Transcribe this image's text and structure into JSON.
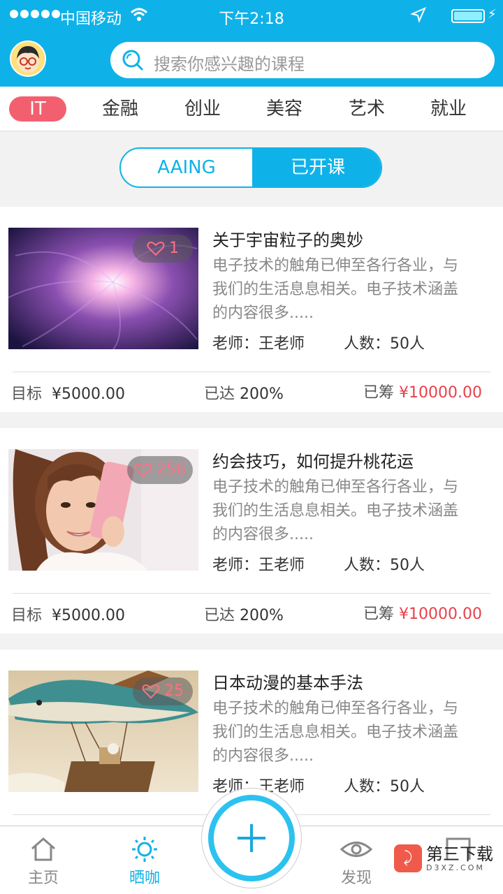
{
  "status_bar": {
    "carrier": "中国移动",
    "time": "下午2:18"
  },
  "search": {
    "placeholder": "搜索你感兴趣的课程"
  },
  "categories": [
    "IT",
    "金融",
    "创业",
    "美容",
    "艺术",
    "就业"
  ],
  "segment": {
    "left": "AAING",
    "right": "已开课"
  },
  "courses": [
    {
      "title": "关于宇宙粒子的奥妙",
      "likes": "1",
      "desc": "电子技术的触角已伸至各行各业，与我们的生活息息相关。电子技术涵盖的内容很多.....",
      "teacher": "老师：王老师",
      "people": "人数：50人",
      "goal_label": "目标",
      "goal": "¥5000.00",
      "reach_label": "已达",
      "reach": "200%",
      "raised_label": "已筹",
      "raised": "¥10000.00"
    },
    {
      "title": "约会技巧，如何提升桃花运",
      "likes": "256",
      "desc": "电子技术的触角已伸至各行各业，与我们的生活息息相关。电子技术涵盖的内容很多.....",
      "teacher": "老师：王老师",
      "people": "人数：50人",
      "goal_label": "目标",
      "goal": "¥5000.00",
      "reach_label": "已达",
      "reach": "200%",
      "raised_label": "已筹",
      "raised": "¥10000.00"
    },
    {
      "title": "日本动漫的基本手法",
      "likes": "25",
      "desc": "电子技术的触角已伸至各行各业，与我们的生活息息相关。电子技术涵盖的内容很多.....",
      "teacher": "老师：王老师",
      "people": "人数：50人"
    }
  ],
  "nav": {
    "home": "主页",
    "shaika": "晒咖",
    "discover": "发现"
  },
  "watermark": {
    "title": "第三下载",
    "sub": "D3XZ.COM"
  },
  "colors": {
    "primary": "#0fb2e8",
    "accent": "#f2606f",
    "price": "#e8414b"
  }
}
